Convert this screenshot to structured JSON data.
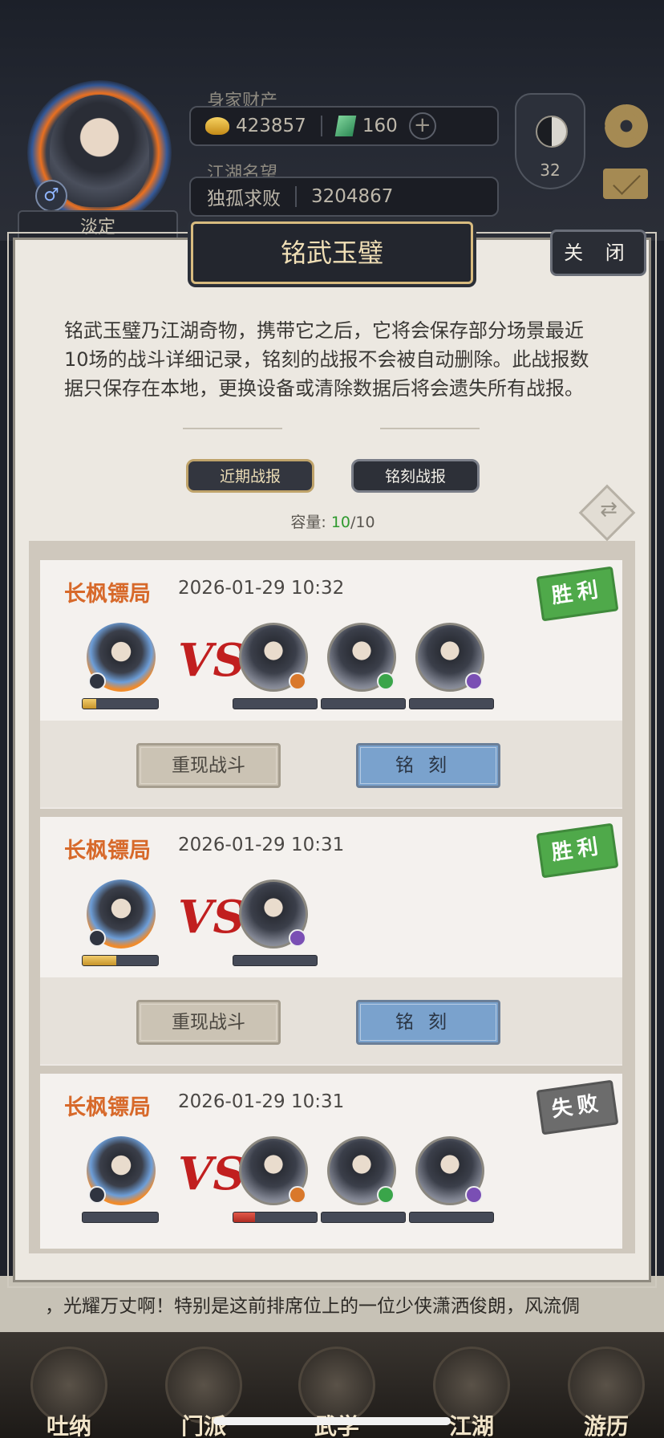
{
  "hud": {
    "wealth_label": "身家财产",
    "gold": "423857",
    "jade": "160",
    "plus": "+",
    "fame_label": "江湖名望",
    "fame_title": "独孤求败",
    "fame_value": "3204867",
    "player_name": "淡定",
    "level": "32",
    "gender_symbol": "♂"
  },
  "panel": {
    "title": "铭武玉璧",
    "close": "关 闭",
    "description": "铭武玉璧乃江湖奇物，携带它之后，它将会保存部分场景最近10场的战斗详细记录，铭刻的战报不会被自动删除。此战报数据只保存在本地，更换设备或清除数据后将会遗失所有战报。",
    "tabs": [
      "近期战报",
      "铭刻战报"
    ],
    "capacity_label": "容量:",
    "capacity_used": "10",
    "capacity_total": "/10"
  },
  "battles": [
    {
      "location": "长枫镖局",
      "time": "2026-01-29 10:32",
      "result": "胜利",
      "self_hp": 0.18,
      "enemies": [
        {
          "badge": "orange",
          "hp": 0
        },
        {
          "badge": "green",
          "hp": 0
        },
        {
          "badge": "purple",
          "hp": 0
        }
      ],
      "replay": "重现战斗",
      "engrave": "铭刻"
    },
    {
      "location": "长枫镖局",
      "time": "2026-01-29 10:31",
      "result": "胜利",
      "self_hp": 0.45,
      "enemies": [
        {
          "badge": "purple",
          "hp": 0
        }
      ],
      "replay": "重现战斗",
      "engrave": "铭刻"
    },
    {
      "location": "长枫镖局",
      "time": "2026-01-29 10:31",
      "result": "失败",
      "self_hp": 0,
      "enemies": [
        {
          "badge": "orange",
          "hp": 0.26
        },
        {
          "badge": "green",
          "hp": 0
        },
        {
          "badge": "purple",
          "hp": 0
        }
      ]
    }
  ],
  "vs_text": "VS",
  "story_text": "，光耀万丈啊！特别是这前排席位上的一位少侠潇洒俊朗，风流倜",
  "nav": [
    "吐纳",
    "门派",
    "武学",
    "江湖",
    "游历"
  ],
  "colors": {
    "win": "#4fa94a",
    "lose": "#6c6c6c",
    "escort": "#d7692a",
    "vs": "#c11f1f"
  }
}
